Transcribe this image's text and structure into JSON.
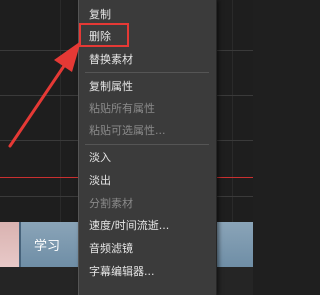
{
  "timeline": {
    "clip_label": "学习"
  },
  "context_menu": {
    "items": [
      {
        "label": "复制",
        "enabled": true
      },
      {
        "label": "删除",
        "enabled": true
      },
      {
        "label": "替换素材",
        "enabled": true
      },
      {
        "label": "复制属性",
        "enabled": true
      },
      {
        "label": "粘贴所有属性",
        "enabled": false
      },
      {
        "label": "粘贴可选属性...",
        "enabled": false
      },
      {
        "label": "淡入",
        "enabled": true
      },
      {
        "label": "淡出",
        "enabled": true
      },
      {
        "label": "分割素材",
        "enabled": false
      },
      {
        "label": "速度/时间流逝...",
        "enabled": true
      },
      {
        "label": "音频滤镜",
        "enabled": true
      },
      {
        "label": "字幕编辑器...",
        "enabled": true
      }
    ]
  },
  "colors": {
    "annotation": "#e53935",
    "menu_background": "#3b3b3b",
    "clip": "#7b98ad",
    "playhead": "#c93030"
  }
}
